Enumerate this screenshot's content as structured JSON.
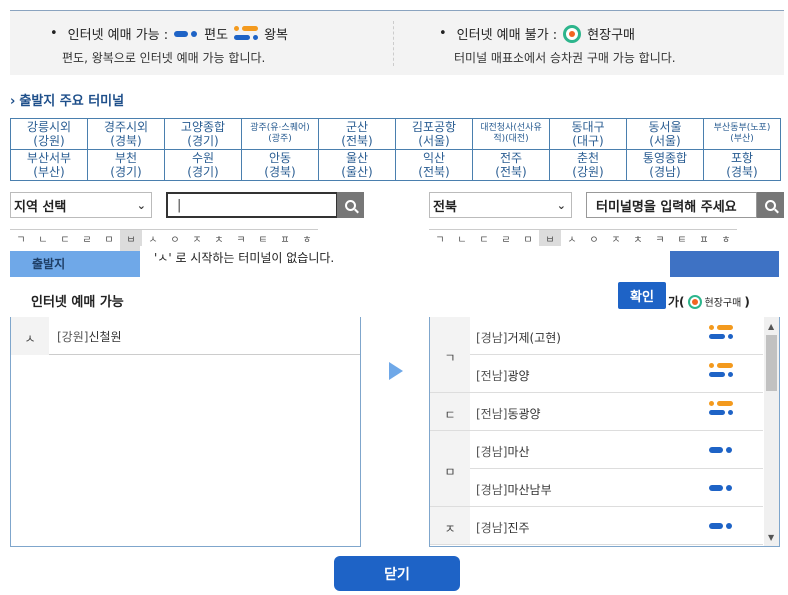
{
  "legend": {
    "online": {
      "bullet": "•",
      "label": "인터넷 예매 가능 :",
      "oneway": "편도",
      "round": "왕복",
      "desc": "편도, 왕복으로 인터넷 예매 가능 합니다."
    },
    "offline": {
      "bullet": "•",
      "label": "인터넷 예매 불가 :",
      "spot": "현장구매",
      "desc": "터미널 매표소에서 승차권 구매 가능 합니다."
    }
  },
  "section_title": "출발지 주요 터미널",
  "major_terminals": [
    [
      {
        "n": "강릉시외",
        "r": "(강원)"
      },
      {
        "n": "경주시외",
        "r": "(경북)"
      },
      {
        "n": "고양종합",
        "r": "(경기)"
      },
      {
        "n": "광주(유·스퀘어)",
        "r": "(광주)",
        "sm": true
      },
      {
        "n": "군산",
        "r": "(전북)"
      },
      {
        "n": "김포공항",
        "r": "(서울)"
      },
      {
        "n": "대전청사(선사유",
        "r": "적)(대전)",
        "sm": true
      },
      {
        "n": "동대구",
        "r": "(대구)"
      },
      {
        "n": "동서울",
        "r": "(서울)"
      },
      {
        "n": "부산동부(노포)",
        "r": "(부산)",
        "sm": true
      }
    ],
    [
      {
        "n": "부산서부",
        "r": "(부산)"
      },
      {
        "n": "부천",
        "r": "(경기)"
      },
      {
        "n": "수원",
        "r": "(경기)"
      },
      {
        "n": "안동",
        "r": "(경북)"
      },
      {
        "n": "울산",
        "r": "(울산)"
      },
      {
        "n": "익산",
        "r": "(전북)"
      },
      {
        "n": "전주",
        "r": "(전북)"
      },
      {
        "n": "춘천",
        "r": "(강원)"
      },
      {
        "n": "통영종합",
        "r": "(경남)"
      },
      {
        "n": "포항",
        "r": "(경북)"
      }
    ]
  ],
  "left_search": {
    "region": "지역 선택",
    "input": "|",
    "arrow": "⌄"
  },
  "right_search": {
    "region": "전북",
    "placeholder": "터미널명을 입력해 주세요",
    "arrow": "⌄"
  },
  "consonants": [
    "ㄱ",
    "ㄴ",
    "ㄷ",
    "ㄹ",
    "ㅁ",
    "ㅂ",
    "ㅅ",
    "ㅇ",
    "ㅈ",
    "ㅊ",
    "ㅋ",
    "ㅌ",
    "ㅍ",
    "ㅎ"
  ],
  "departure_tab": "출발지",
  "tooltip": "'ㅅ' 로 시작하는 터미널이 없습니다.",
  "internet_label": "인터넷 예매 가능",
  "confirm": "확인",
  "ga": {
    "prefix": "가(",
    "spot": "현장구매",
    "suffix": ")"
  },
  "left_list": {
    "cons": "ㅅ",
    "region": "[강원]",
    "name": "신철원"
  },
  "right_list": [
    {
      "cons": "ㄱ",
      "region": "[경남]",
      "name": "거제(고현)",
      "type": "round"
    },
    {
      "cons": "",
      "region": "[전남]",
      "name": "광양",
      "type": "round"
    },
    {
      "cons": "ㄷ",
      "region": "[전남]",
      "name": "동광양",
      "type": "round"
    },
    {
      "cons": "ㅁ",
      "region": "[경남]",
      "name": "마산",
      "type": "oneway"
    },
    {
      "cons": "",
      "region": "[경남]",
      "name": "마산남부",
      "type": "oneway"
    },
    {
      "cons": "ㅈ",
      "region": "[경남]",
      "name": "진주",
      "type": "oneway"
    }
  ],
  "scroll": {
    "up": "▲",
    "down": "▼"
  },
  "close": "닫기"
}
